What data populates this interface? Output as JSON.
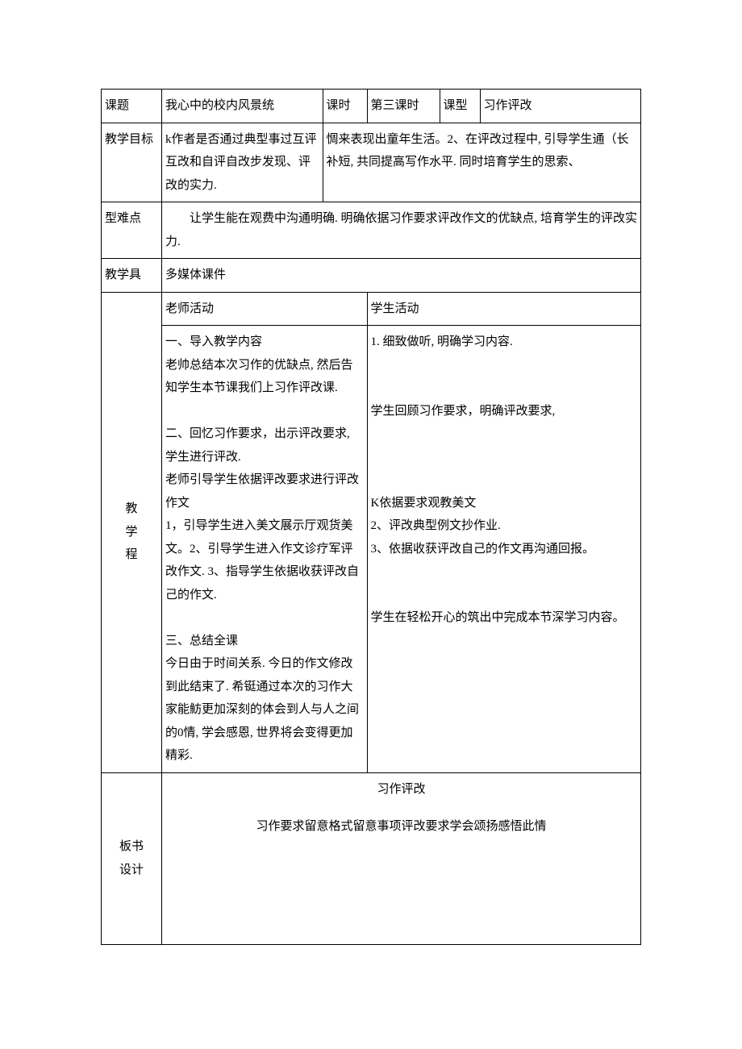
{
  "row1": {
    "topic_label": "课题",
    "topic_value": "我心中的校内风景统",
    "period_label": "课时",
    "period_value": "第三课时",
    "type_label": "课型",
    "type_value": "习作评改"
  },
  "row2": {
    "goal_label": "教学目标",
    "goal_left": "k作者是否通过典型事过互评互改和自评自改步发现、评改的实力.",
    "goal_right": "惆来表现出童年生活。2、在评改过程中, 引导学生通（长补短, 共同提高写作水平. 同时培育学生的思索、"
  },
  "row3": {
    "diff_label": "型难点",
    "diff_value": "        让学生能在观费中沟通明确. 明确依据习作要求评改作文的优缺点, 培育学生的评改实力."
  },
  "row4": {
    "tool_label": "教学具",
    "tool_value": "多媒体课件"
  },
  "process": {
    "side_label_1": "教",
    "side_label_2": "学",
    "side_label_3": "程",
    "teacher_header": "老师活动",
    "student_header": "学生活动",
    "teacher_body": "一、导入教学内容\n老帅总结本次习作的优缺点, 然后告知学生本节课我们上习作评改课.\n\n二、回忆习作要求，出示评改要求, 学生进行评改.\n老师引导学生依据评改要求进行评改作文\n1，引导学生进入美文展示厅观货美文。2、引导学生进入作文诊疗军评改作文. 3、指导学生依据收获评改自己的作文.\n\n三、总结全课\n今日由于时间关系. 今日的作文修改到此结束了. 希铤通过本次的习作大家能魴更加深刻的体会到人与人之间的0情, 学会感恩, 世界将会变得更加精彩.",
    "student_body": "1. 细致做听, 明确学习内容.\n\n\n学生回顾习作要求，明确评改要求,\n\n\n\nK依据要求观教美文\n2、评改典型例文抄作业.\n3、依据收获评改自己的作文再沟通回报。\n\n\n学生在轻松开心的筑出中完成本节深学习内容。"
  },
  "board": {
    "side_label": "板书\n设计",
    "title": "习作评改",
    "content": "习作要求留意格式留意事项评改要求学会颂扬感悟此情"
  }
}
